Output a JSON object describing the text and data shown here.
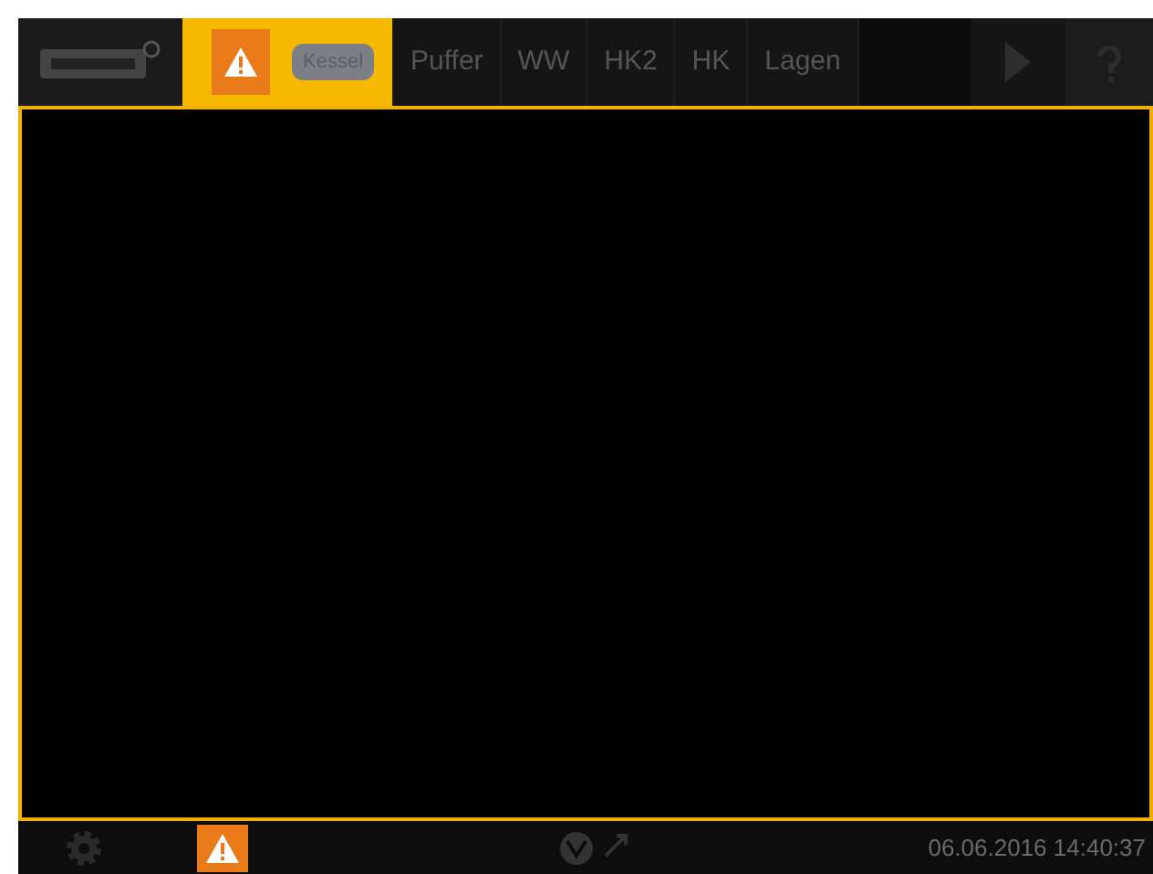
{
  "top_bar": {
    "tabs": [
      {
        "kind": "alert",
        "label": "Kessel",
        "selected": true
      },
      {
        "kind": "text",
        "label": "Puffer",
        "selected": false
      },
      {
        "kind": "text",
        "label": "WW",
        "selected": false
      },
      {
        "kind": "text",
        "label": "HK2",
        "selected": false
      },
      {
        "kind": "text",
        "label": "HK",
        "selected": false
      },
      {
        "kind": "text",
        "label": "Lagen",
        "selected": false
      }
    ]
  },
  "status_bar": {
    "alert": true,
    "datetime": "06.06.2016 14:40:37"
  }
}
